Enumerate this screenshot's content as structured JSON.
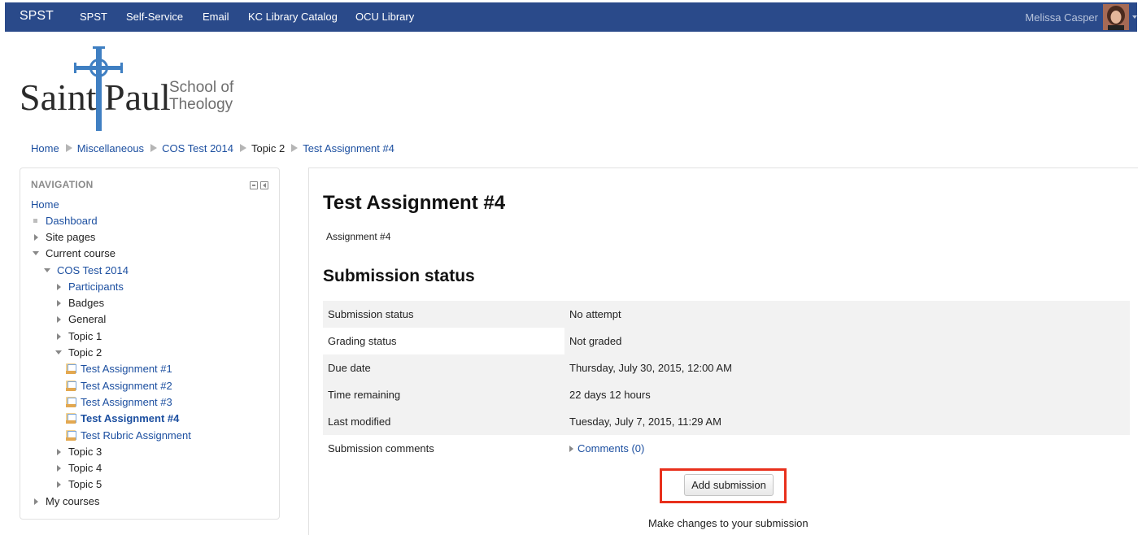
{
  "navbar": {
    "brand": "SPST",
    "links": [
      "SPST",
      "Self-Service",
      "Email",
      "KC Library Catalog",
      "OCU Library"
    ],
    "user_name": "Melissa Casper",
    "bg_color": "#2a4a8a"
  },
  "logo": {
    "line1_a": "Saint",
    "line1_b": "Paul",
    "line2_a": "School of",
    "line2_b": "Theology"
  },
  "breadcrumb": {
    "items": [
      "Home",
      "Miscellaneous",
      "COS Test 2014",
      "Topic 2",
      "Test Assignment #4"
    ]
  },
  "navigation": {
    "title": "NAVIGATION",
    "items": [
      {
        "label": "Home"
      },
      {
        "label": "Dashboard"
      },
      {
        "label": "Site pages"
      },
      {
        "label": "Current course"
      },
      {
        "label": "COS Test 2014"
      },
      {
        "label": "Participants"
      },
      {
        "label": "Badges"
      },
      {
        "label": "General"
      },
      {
        "label": "Topic 1"
      },
      {
        "label": "Topic 2"
      },
      {
        "label": "Test Assignment #1"
      },
      {
        "label": "Test Assignment #2"
      },
      {
        "label": "Test Assignment #3"
      },
      {
        "label": "Test Assignment #4"
      },
      {
        "label": "Test Rubric Assignment"
      },
      {
        "label": "Topic 3"
      },
      {
        "label": "Topic 4"
      },
      {
        "label": "Topic 5"
      },
      {
        "label": "My courses"
      }
    ]
  },
  "main": {
    "title": "Test Assignment #4",
    "intro": "Assignment #4",
    "section_title": "Submission status",
    "rows": [
      {
        "label": "Submission status",
        "value": "No attempt"
      },
      {
        "label": "Grading status",
        "value": "Not graded"
      },
      {
        "label": "Due date",
        "value": "Thursday, July 30, 2015, 12:00 AM"
      },
      {
        "label": "Time remaining",
        "value": "22 days 12 hours"
      },
      {
        "label": "Last modified",
        "value": "Tuesday, July 7, 2015, 11:29 AM"
      },
      {
        "label": "Submission comments",
        "value": "Comments (0)"
      }
    ],
    "add_button": "Add submission",
    "help_text": "Make changes to your submission",
    "highlight_color": "#e8301c"
  }
}
